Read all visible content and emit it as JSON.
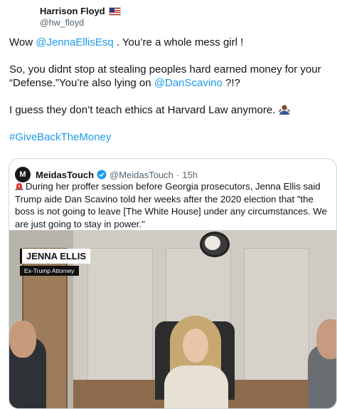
{
  "author": {
    "name": "Harrison Floyd",
    "flag_icon": "us-flag-icon",
    "handle": "@hw_floyd"
  },
  "tweet": {
    "line1_pre": "Wow ",
    "line1_mention": "@JennaEllisEsq",
    "line1_post": " . You’re a whole mess girl !",
    "line2_pre": "So, you didnt stop at stealing peoples hard earned money for your “Defense.”You’re also lying on ",
    "line2_mention": "@DanScavino",
    "line2_post": " ?!?",
    "line3": "I guess they don’t teach ethics at Harvard Law anymore. ",
    "line3_emoji": "man-shrugging-emoji",
    "hashtag": "#GiveBackTheMoney"
  },
  "quote": {
    "avatar_letter": "M",
    "name": "MeidasTouch",
    "verified_icon": "verified-badge-icon",
    "handle": "@MeidasTouch",
    "separator": "·",
    "time": "15h",
    "siren_icon": "siren-icon",
    "text": "During her proffer session before Georgia prosecutors, Jenna Ellis said Trump aide Dan Scavino told her weeks after the 2020 election that \"the boss is not going to leave [The White House] under any circumstances. We are just going to stay in power.\"",
    "photo": {
      "lower_third_name": "JENNA ELLIS",
      "lower_third_title": "Ex-Trump Attorney"
    }
  },
  "colors": {
    "link": "#1d9bf0",
    "secondary": "#536471",
    "border": "#cfd9de"
  }
}
